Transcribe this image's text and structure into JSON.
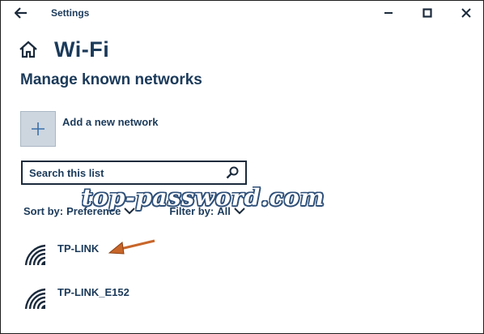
{
  "window": {
    "title": "Settings"
  },
  "header": {
    "title": "Wi-Fi"
  },
  "section": {
    "title": "Manage known networks"
  },
  "add_network": {
    "label": "Add a new network"
  },
  "search": {
    "placeholder": "Search this list"
  },
  "watermark": {
    "text": "top-password.com"
  },
  "sort": {
    "label": "Sort by:",
    "value": "Preference"
  },
  "filter": {
    "label": "Filter by:",
    "value": "All"
  },
  "networks": [
    {
      "name": "TP-LINK"
    },
    {
      "name": "TP-LINK_E152"
    }
  ],
  "icons": {
    "back": "back-arrow-icon",
    "minimize": "minimize-icon",
    "maximize": "maximize-icon",
    "close": "close-icon",
    "home": "home-icon",
    "add": "plus-icon",
    "search": "search-icon",
    "chevron": "chevron-down-icon",
    "wifi": "wifi-signal-icon"
  },
  "colors": {
    "text": "#1b3a5a",
    "tile": "#cdd6df",
    "accent": "#2e4f78",
    "arrow": "#c8662a"
  }
}
